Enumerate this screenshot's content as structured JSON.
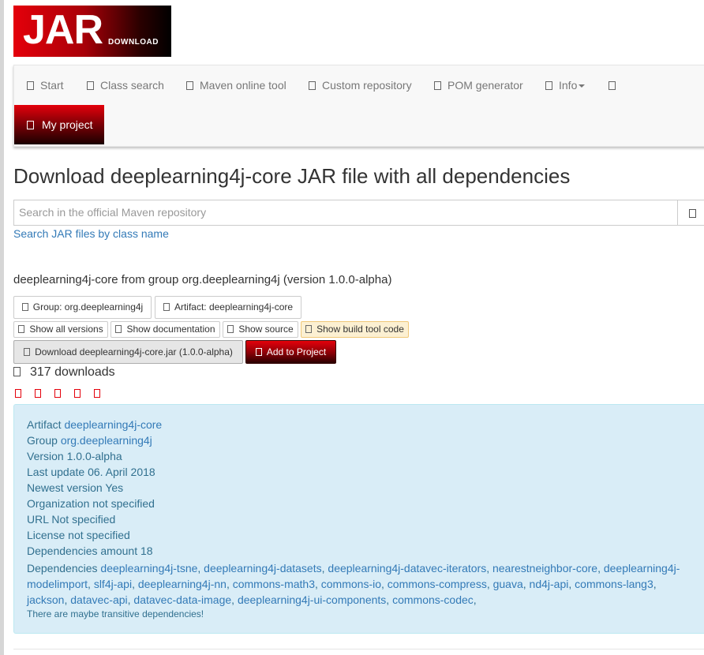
{
  "logo": {
    "main": "JAR",
    "sub": "DOWNLOAD"
  },
  "nav": {
    "items": [
      "Start",
      "Class search",
      "Maven online tool",
      "Custom repository",
      "POM generator",
      "Info"
    ],
    "my_project": "My project"
  },
  "page_title": "Download deeplearning4j-core JAR file with all dependencies",
  "search": {
    "placeholder": "Search in the official Maven repository",
    "class_link": "Search JAR files by class name"
  },
  "artifact_summary": "deeplearning4j-core from group org.deeplearning4j (version 1.0.0-alpha)",
  "buttons": {
    "group": "Group: org.deeplearning4j",
    "artifact": "Artifact: deeplearning4j-core",
    "show_all_versions": "Show all versions",
    "show_documentation": "Show documentation",
    "show_source": "Show source",
    "show_build_tool_code": "Show build tool code",
    "download": "Download deeplearning4j-core.jar (1.0.0-alpha)",
    "add_to_project": "Add to Project"
  },
  "downloads": "317 downloads",
  "rating": {
    "stars": 5
  },
  "info": {
    "artifact": {
      "label": "Artifact",
      "value": "deeplearning4j-core"
    },
    "group": {
      "label": "Group",
      "value": "org.deeplearning4j"
    },
    "version": {
      "label": "Version",
      "value": "1.0.0-alpha"
    },
    "last_update": {
      "label": "Last update",
      "value": "06. April 2018"
    },
    "newest_version": {
      "label": "Newest version",
      "value": "Yes"
    },
    "organization": {
      "label": "Organization",
      "value": "not specified"
    },
    "url": {
      "label": "URL",
      "value": "Not specified"
    },
    "license": {
      "label": "License",
      "value": "not specified"
    },
    "dependencies_amount": {
      "label": "Dependencies amount",
      "value": "18"
    },
    "dependencies_label": "Dependencies",
    "dependencies": [
      "deeplearning4j-tsne",
      "deeplearning4j-datasets",
      "deeplearning4j-datavec-iterators",
      "nearestneighbor-core",
      "deeplearning4j-modelimport",
      "slf4j-api",
      "deeplearning4j-nn",
      "commons-math3",
      "commons-io",
      "commons-compress",
      "guava",
      "nd4j-api",
      "commons-lang3",
      "jackson",
      "datavec-api",
      "datavec-data-image",
      "deeplearning4j-ui-components",
      "commons-codec"
    ],
    "transitive_note": "There are maybe transitive dependencies!"
  },
  "colors": {
    "brand_red": "#e4000b",
    "link": "#337ab7",
    "info_bg": "#d9edf7",
    "warning_bg": "#fcf0d2"
  }
}
